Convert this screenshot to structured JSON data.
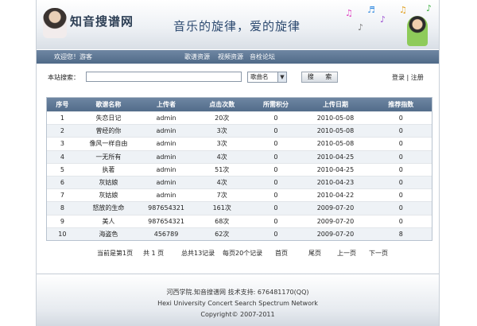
{
  "header": {
    "site_name": "知音搜谱网",
    "slogan": "音乐的旋律，爱的旋律"
  },
  "nav": {
    "welcome": "欢迎您！游客",
    "links": [
      "歌谱资源",
      "视频资源",
      "音栓论坛"
    ]
  },
  "search": {
    "label": "本站搜索：",
    "value": "",
    "select_value": "歌曲名",
    "button_label": "搜 索",
    "login": "登录",
    "separator": "|",
    "register": "注册"
  },
  "table": {
    "columns": [
      "序号",
      "歌谱名称",
      "上传者",
      "点击次数",
      "所需积分",
      "上传日期",
      "推荐指数"
    ],
    "rows": [
      [
        "1",
        "失恋日记",
        "admin",
        "20次",
        "0",
        "2010-05-08",
        "0"
      ],
      [
        "2",
        "曾经的你",
        "admin",
        "3次",
        "0",
        "2010-05-08",
        "0"
      ],
      [
        "3",
        "像风一样自由",
        "admin",
        "3次",
        "0",
        "2010-05-08",
        "0"
      ],
      [
        "4",
        "一无所有",
        "admin",
        "4次",
        "0",
        "2010-04-25",
        "0"
      ],
      [
        "5",
        "执著",
        "admin",
        "51次",
        "0",
        "2010-04-25",
        "0"
      ],
      [
        "6",
        "灰姑娘",
        "admin",
        "4次",
        "0",
        "2010-04-23",
        "0"
      ],
      [
        "7",
        "灰姑娘",
        "admin",
        "7次",
        "0",
        "2010-04-22",
        "0"
      ],
      [
        "8",
        "怒放的生命",
        "987654321",
        "161次",
        "0",
        "2009-07-20",
        "0"
      ],
      [
        "9",
        "美人",
        "987654321",
        "68次",
        "0",
        "2009-07-20",
        "0"
      ],
      [
        "10",
        "海盗色",
        "456789",
        "62次",
        "0",
        "2009-07-20",
        "8"
      ]
    ]
  },
  "pager": {
    "current": "当前是第1页",
    "total_pages": "共 1 页",
    "total_records": "总共13记录",
    "per_page": "每页20个记录",
    "first": "首页",
    "last": "尾页",
    "prev": "上一页",
    "next": "下一页"
  },
  "footer": {
    "line1": "河西学院.知音搜谱网    技术支持: 676481170(QQ)",
    "line2": "Hexi University Concert Search Spectrum Network",
    "line3": "Copyright© 2007-2011"
  },
  "colors": {
    "nav_bg": "#5a7391",
    "title": "#2d3f55"
  }
}
